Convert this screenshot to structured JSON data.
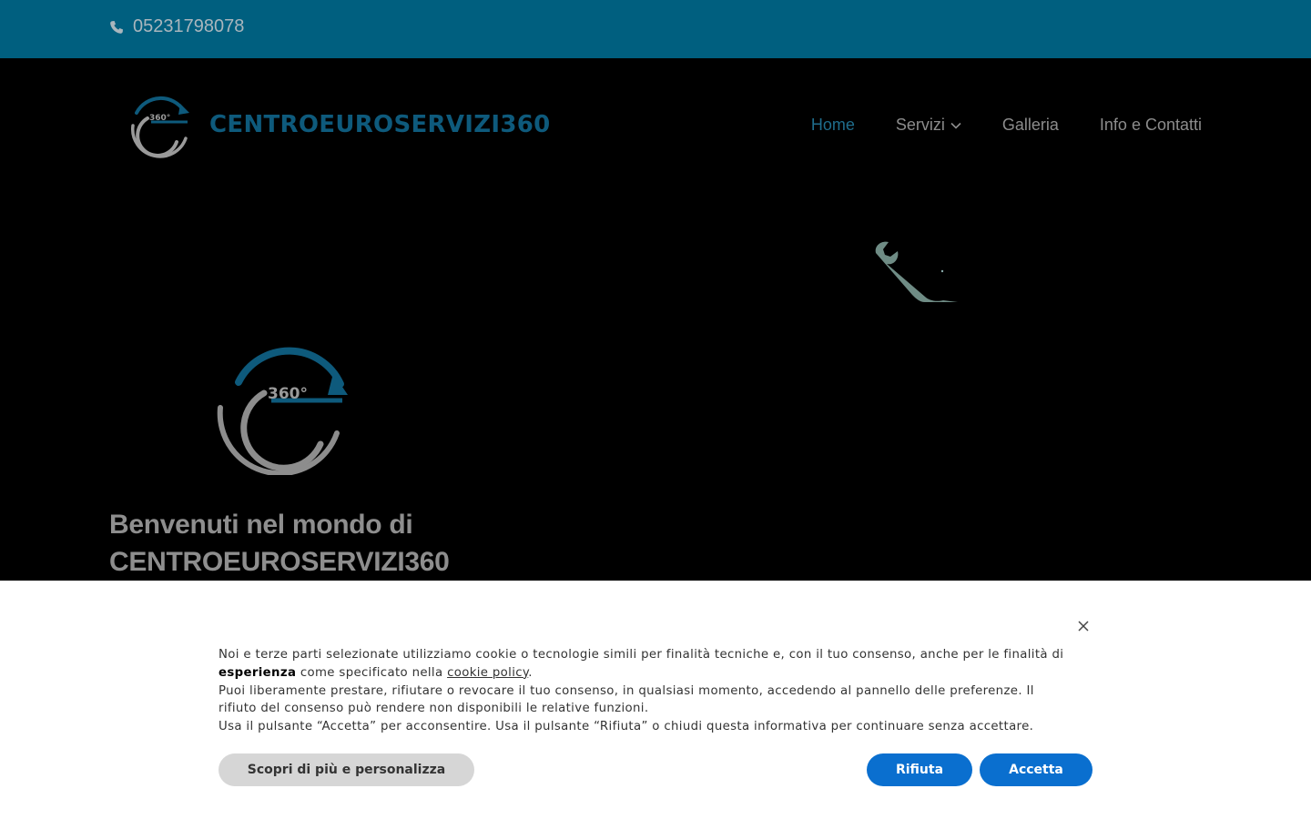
{
  "topbar": {
    "phone": "05231798078",
    "phone_icon": "phone-icon"
  },
  "header": {
    "brand": "CENTROEUROSERVIZI360",
    "logo_text": "360°",
    "nav": [
      {
        "label": "Home",
        "active": true
      },
      {
        "label": "Servizi",
        "has_dropdown": true
      },
      {
        "label": "Galleria"
      },
      {
        "label": "Info e Contatti"
      }
    ]
  },
  "hero": {
    "title_line1": "Benvenuti nel mondo di",
    "title_line2": "CENTROEUROSERVIZI360",
    "mark_text": "360°"
  },
  "cookie_banner": {
    "p1_a": "Noi e terze parti selezionate utilizziamo cookie o tecnologie simili per finalità tecniche e, con il tuo consenso, anche per le finalità di",
    "p1_bold": "esperienza",
    "p1_b": "come specificato nella",
    "p1_link": "cookie policy",
    "p1_end": ".",
    "p2": "Puoi liberamente prestare, rifiutare o revocare il tuo consenso, in qualsiasi momento, accedendo al pannello delle preferenze. Il rifiuto del consenso può rendere non disponibili le relative funzioni.",
    "p3": "Usa il pulsante “Accetta” per acconsentire. Usa il pulsante “Rifiuta” o chiudi questa informativa per continuare senza accettare.",
    "btn_more": "Scopri di più e personalizza",
    "btn_reject": "Rifiuta",
    "btn_accept": "Accetta"
  },
  "colors": {
    "topbar": "#005f7f",
    "accent": "#1f6d8c",
    "button_blue": "#0a6fcf"
  }
}
